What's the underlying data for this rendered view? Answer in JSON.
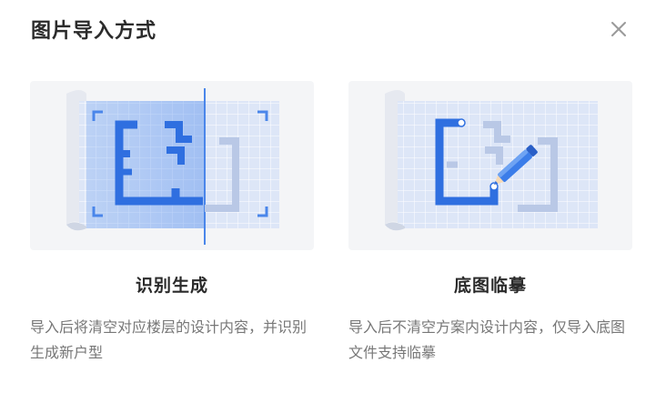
{
  "dialog": {
    "title": "图片导入方式",
    "close_icon": "close-icon"
  },
  "options": [
    {
      "title": "识别生成",
      "description": "导入后将清空对应楼层的设计内容，并识别生成新户型",
      "illustration": "blueprint-scan-illustration"
    },
    {
      "title": "底图临摹",
      "description": "导入后不清空方案内设计内容，仅导入底图文件支持临摹",
      "illustration": "blueprint-trace-illustration"
    }
  ],
  "colors": {
    "accent": "#3b7de9",
    "card_background": "#f4f5f7",
    "title_text": "#2b2b2b",
    "description_text": "#777777"
  }
}
